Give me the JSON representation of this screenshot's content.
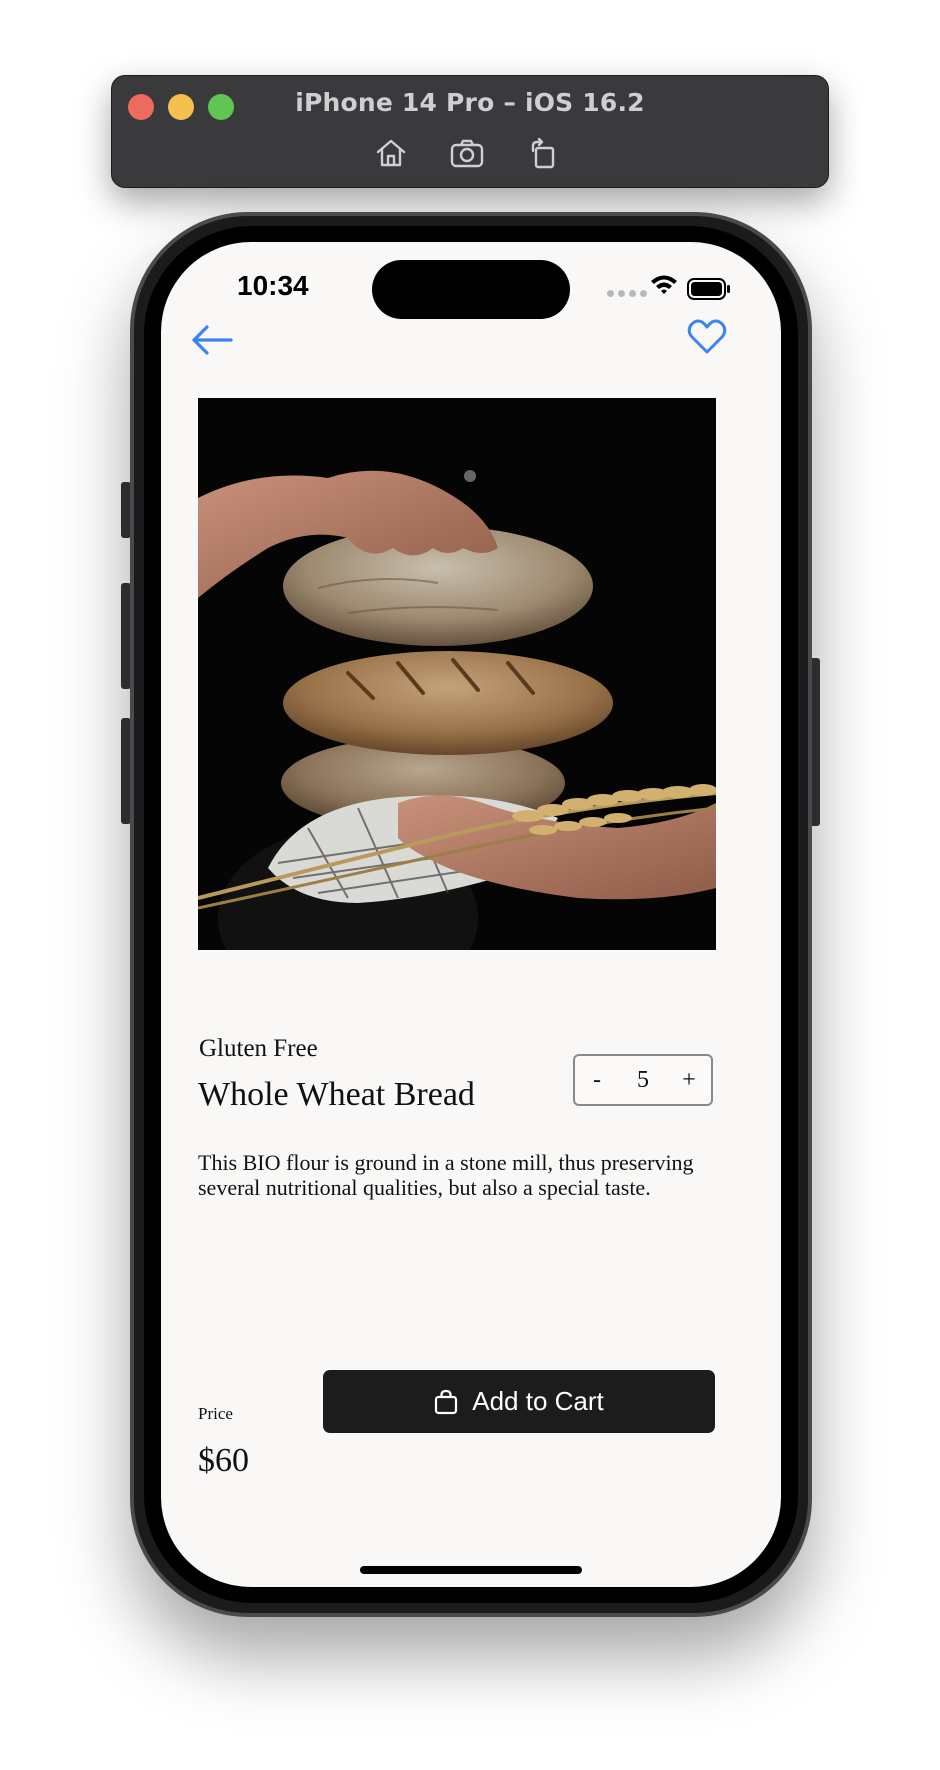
{
  "simulator": {
    "title": "iPhone 14 Pro – iOS 16.2",
    "tools": [
      "home-icon",
      "screenshot-icon",
      "rotate-icon"
    ]
  },
  "status_bar": {
    "time": "10:34"
  },
  "nav": {
    "back_icon": "arrow-left-icon",
    "favorite_icon": "heart-icon",
    "accent_color": "#3b82f6"
  },
  "product": {
    "image": "bread-loaves-photo",
    "subtitle": "Gluten Free",
    "name": "Whole Wheat Bread",
    "quantity": "5",
    "decrement_label": "-",
    "increment_label": "+",
    "description": "This BIO flour is ground in a stone mill, thus preserving several nutritional qualities, but also a special taste.",
    "price_label": "Price",
    "price": "$60"
  },
  "cart": {
    "button_label": "Add to Cart",
    "button_icon": "bag-icon"
  }
}
